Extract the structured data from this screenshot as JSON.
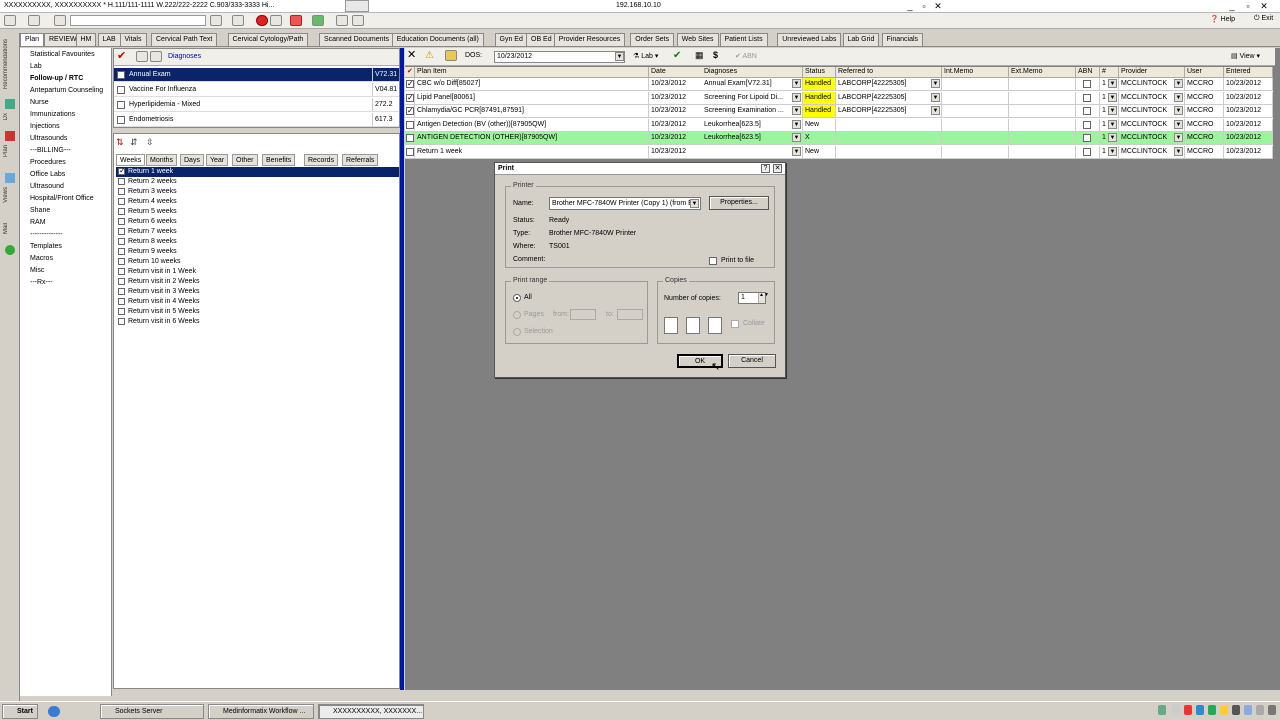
{
  "titlebar": {
    "patient": "XXXXXXXXXX, XXXXXXXXXX  * H.111/111-1111 W.222/222-2222 C.903/333-3333 Hi...",
    "host_ip": "192.168.10.10"
  },
  "toolbar": {
    "help_label": "Help",
    "exit_label": "Exit"
  },
  "tabs": [
    "Plan",
    "REVIEW",
    "HM",
    "LAB",
    "Vitals",
    "Cervical Path Text",
    "Cervical Cytology/Path",
    "Scanned Documents",
    "Education Documents (all)",
    "Gyn Ed",
    "OB Ed",
    "Provider Resources",
    "Order Sets",
    "Web Sites",
    "Patient Lists",
    "Unreviewed Labs",
    "Lab Grid",
    "Financials"
  ],
  "side_strip": [
    "Recommendations",
    "Dx",
    "Plan",
    "Views",
    "Mail"
  ],
  "left_nav": [
    "Statistical Favourites",
    "Lab",
    "Follow-up / RTC",
    "Antepartum Counseling",
    "Nurse",
    "Immunizations",
    "Injections",
    "Ultrasounds",
    "---BILLING---",
    "Procedures",
    "Office Labs",
    "Ultrasound",
    "Hospital/Front Office",
    "Shane",
    "RAM",
    "--------------",
    "Templates",
    "Macros",
    "Misc",
    "---Rx---"
  ],
  "diagnoses": {
    "header": "Diagnoses",
    "rows": [
      {
        "name": "Annual Exam",
        "code": "V72.31",
        "checked": false,
        "selected": true
      },
      {
        "name": "Vaccine For Influenza",
        "code": "V04.81",
        "checked": false,
        "selected": false
      },
      {
        "name": "Hyperlipidemia - Mixed",
        "code": "272.2",
        "checked": false,
        "selected": false
      },
      {
        "name": "Endometriosis",
        "code": "617.3",
        "checked": false,
        "selected": false
      }
    ]
  },
  "subtabs": [
    "Weeks",
    "Months",
    "Days",
    "Year",
    "Other",
    "Benefits",
    "Records",
    "Referrals"
  ],
  "return_items": [
    {
      "label": "Return  1 week",
      "checked": true
    },
    {
      "label": "Return  2 weeks",
      "checked": false
    },
    {
      "label": "Return  3 weeks",
      "checked": false
    },
    {
      "label": "Return  4 weeks",
      "checked": false
    },
    {
      "label": "Return  5 weeks",
      "checked": false
    },
    {
      "label": "Return  6 weeks",
      "checked": false
    },
    {
      "label": "Return  7 weeks",
      "checked": false
    },
    {
      "label": "Return  8 weeks",
      "checked": false
    },
    {
      "label": "Return  9 weeks",
      "checked": false
    },
    {
      "label": "Return 10 weeks",
      "checked": false
    },
    {
      "label": "Return visit in 1 Week",
      "checked": false
    },
    {
      "label": "Return visit in 2 Weeks",
      "checked": false
    },
    {
      "label": "Return visit in 3 Weeks",
      "checked": false
    },
    {
      "label": "Return visit in 4 Weeks",
      "checked": false
    },
    {
      "label": "Return visit in 5 Weeks",
      "checked": false
    },
    {
      "label": "Return visit in 6 Weeks",
      "checked": false
    }
  ],
  "plan_toolbar": {
    "dos_label": "DOS:",
    "dos_value": "10/23/2012",
    "lab_label": "Lab",
    "abn_label": "ABN",
    "view_label": "View"
  },
  "plan_grid": {
    "headers": [
      "Plan Item",
      "Date",
      "Diagnoses",
      "Status",
      "Referred to",
      "Int.Memo",
      "Ext.Memo",
      "ABN",
      "#",
      "Provider",
      "User",
      "Entered"
    ],
    "rows": [
      {
        "item": "CBC w/o Diff[85027]",
        "date": "10/23/2012",
        "dx": "Annual Exam[V72.31]",
        "status": "Handled",
        "ref": "LABCORP[42225305]",
        "num": "1",
        "provider": "MCCLINTOCK",
        "user": "MCCRO",
        "entered": "10/23/2012",
        "checked": true,
        "status_color": "#ffff00",
        "row_bg": "#ffffff"
      },
      {
        "item": "Lipid Panel[80061]",
        "date": "10/23/2012",
        "dx": "Screening For Lipoid Di...",
        "status": "Handled",
        "ref": "LABCORP[42225305]",
        "num": "1",
        "provider": "MCCLINTOCK",
        "user": "MCCRO",
        "entered": "10/23/2012",
        "checked": true,
        "status_color": "#ffff00",
        "row_bg": "#ffffff"
      },
      {
        "item": "Chlamydia/GC PCR[87491,87591]",
        "date": "10/23/2012",
        "dx": "Screening Examination ...",
        "status": "Handled",
        "ref": "LABCORP[42225305]",
        "num": "1",
        "provider": "MCCLINTOCK",
        "user": "MCCRO",
        "entered": "10/23/2012",
        "checked": true,
        "status_color": "#ffff00",
        "row_bg": "#ffffff"
      },
      {
        "item": "Antigen Detection (BV (other))[87905QW]",
        "date": "10/23/2012",
        "dx": "Leukorrhea[623.5]",
        "status": "New",
        "ref": "",
        "num": "1",
        "provider": "MCCLINTOCK",
        "user": "MCCRO",
        "entered": "10/23/2012",
        "checked": false,
        "status_color": "#ffffff",
        "row_bg": "#ffffff"
      },
      {
        "item": "ANTIGEN DETECTION (OTHER)[87905QW]",
        "date": "10/23/2012",
        "dx": "Leukorrhea[623.5]",
        "status": "X",
        "ref": "",
        "num": "1",
        "provider": "MCCLINTOCK",
        "user": "MCCRO",
        "entered": "10/23/2012",
        "checked": false,
        "status_color": "#9cf59c",
        "row_bg": "#9cf59c"
      },
      {
        "item": "Return  1 week",
        "date": "10/23/2012",
        "dx": "",
        "status": "New",
        "ref": "",
        "num": "1",
        "provider": "MCCLINTOCK",
        "user": "MCCRO",
        "entered": "10/23/2012",
        "checked": false,
        "status_color": "#ffffff",
        "row_bg": "#ffffff"
      }
    ]
  },
  "print_dialog": {
    "title": "Print",
    "printer_group": "Printer",
    "name_label": "Name:",
    "name_value": "Brother MFC-7840W Printer (Copy 1) (from E",
    "properties_label": "Properties...",
    "status_label": "Status:",
    "status_value": "Ready",
    "type_label": "Type:",
    "type_value": "Brother MFC-7840W Printer",
    "where_label": "Where:",
    "where_value": "TS001",
    "comment_label": "Comment:",
    "print_to_file": "Print to file",
    "range_group": "Print range",
    "range_all": "All",
    "range_pages": "Pages",
    "range_from": "from:",
    "range_to": "to:",
    "range_selection": "Selection",
    "copies_group": "Copies",
    "num_copies_label": "Number of copies:",
    "num_copies_value": "1",
    "collate_label": "Collate",
    "ok_label": "OK",
    "cancel_label": "Cancel"
  },
  "taskbar": {
    "start_label": "Start",
    "items": [
      "Sockets Server",
      "Medinformatix Workflow ...",
      "XXXXXXXXXX, XXXXXXX..."
    ]
  }
}
